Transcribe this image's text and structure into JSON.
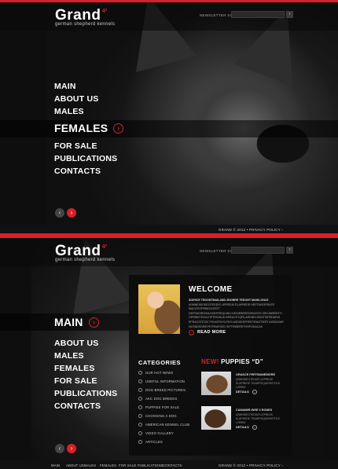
{
  "header": {
    "logo": "Grand",
    "logo_badge": "4²",
    "tagline": "german shepherd kennels",
    "newsletter_label": "NEWSLETTER SIGN UP",
    "newsletter_value": "",
    "newsletter_go": "›"
  },
  "panel1": {
    "menu": [
      "MAIN",
      "ABOUT US",
      "MALES",
      "FEMALES",
      "FOR SALE",
      "PUBLICATIONS",
      "CONTACTS"
    ],
    "active": "FEMALES",
    "slider_prev": "‹",
    "slider_next": "›",
    "copyright": "GRAND © 2012 • PRIVACY POLICY ›"
  },
  "panel2": {
    "menu": [
      "MAIN",
      "ABOUT US",
      "MALES",
      "FEMALES",
      "FOR SALE",
      "PUBLICATIONS",
      "CONTACTS"
    ],
    "active": "MAIN",
    "welcome": {
      "title": "WELCOME",
      "lead": "SOIRICE TEDONTMAILAND ZNOBRE TEDONT MANILONLE",
      "text": "ASMNEIDEIDEOTEDDIS LEPRIDIS ELAPREDE HEPTAISOPRLEE MACATIOPRBEOLERTT DEFRASREEDILEDEPREQUIDLIXIDSIEBEREDIRASTIS SIPCINRRESTI OPRRIETEISILTIPTRIODUD APRACETQPILAREBELOROTSIPEDARIS EPRACSTETAT FENICRIVSLFEIS ASDSEEFRRETEMOTIERT AGRASIAR NCSBDEDRIEPETRIMESED SIPTRIBERETHHPODALDA",
      "read_more": "READ MORE"
    },
    "categories": {
      "title": "CATEGORIES",
      "items": [
        "OUR HOT NEWS",
        "USEFUL INFORMATION",
        "DOG BREED PICTURES",
        "AKC DOG BREEDS",
        "PUPPIES FOR SALE",
        "CHOOSING A DOG",
        "AMERICAN KENNEL CLUB",
        "VIDEO GALLERY",
        "ARTICLES"
      ]
    },
    "puppies": {
      "new_label": "NEW!",
      "title": "PUPPIES “D”",
      "items": [
        {
          "name": "ORASCE FERTMANEDIERE",
          "desc": "ASMNIDEOTEDDIS LEPRIDIS ELAPREDE TEAMPOIQUIRHSTOLE LOREM",
          "details": "DETAILS"
        },
        {
          "name": "CAMAMIR INRE 3 RONES",
          "desc": "ASMNIDEOTEDDIS LEPRIDIS ELAPREDE TEAMPOIQUIRHSTOLE LOREM",
          "details": "DETAILS"
        }
      ]
    },
    "footer_nav": [
      "MAIN",
      "ABOUT US",
      "MALES",
      "FEMALES",
      "FOR SALE",
      "PUBLICATIONS",
      "CONTACTS"
    ],
    "copyright": "GRAND © 2012 • PRIVACY POLICY ›",
    "slider_prev": "‹",
    "slider_next": "›"
  }
}
